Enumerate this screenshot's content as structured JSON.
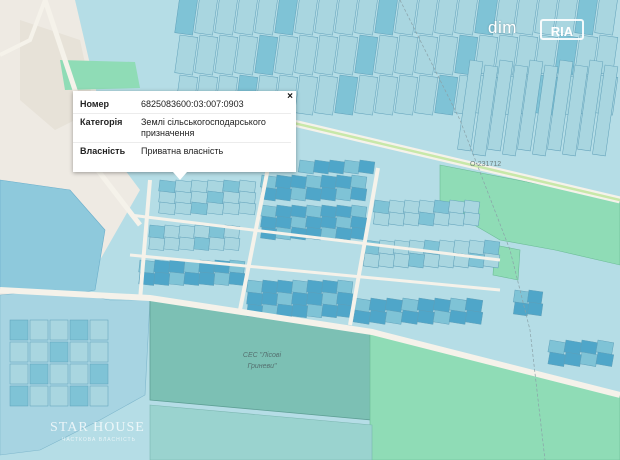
{
  "popup": {
    "close": "×",
    "rows": [
      {
        "key": "Номер",
        "value": "6825083600:03:007:0903"
      },
      {
        "key": "Категорія",
        "value": "Землі сільськогосподарського призначення"
      },
      {
        "key": "Власність",
        "value": "Приватна власність"
      }
    ]
  },
  "map": {
    "area_label_line1": "СЕС \"Лісові",
    "area_label_line2": "Гриневи\"",
    "road_label": "О-231712"
  },
  "logo": {
    "part1": "dim",
    "part2": "RIA"
  },
  "watermark": {
    "name": "STAR HOUSE",
    "sub": "ЧАСТКОВА ВЛАСНІСТЬ"
  },
  "colors": {
    "parcel_light": "#a9d6e0",
    "parcel_medium": "#7fc3d6",
    "parcel_dark": "#4fa6c9",
    "green_area": "#8fdcb6",
    "road": "#f5f2ea",
    "background": "#eeeae3"
  }
}
